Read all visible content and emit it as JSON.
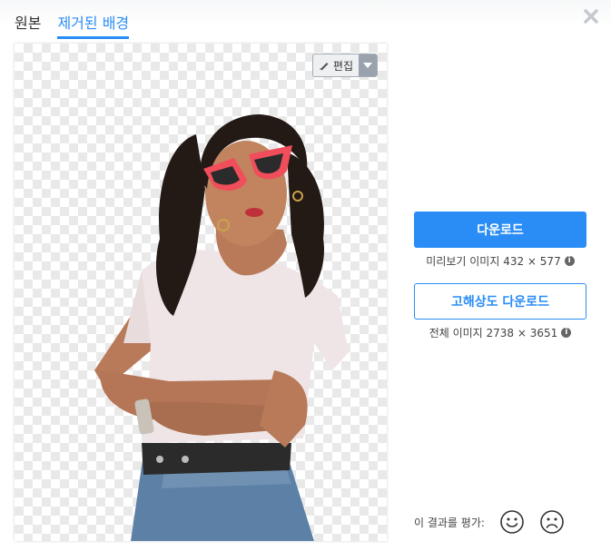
{
  "tabs": [
    {
      "label": "원본",
      "active": false
    },
    {
      "label": "제거된 배경",
      "active": true
    }
  ],
  "close": {
    "icon": "close-icon"
  },
  "preview": {
    "edit_label": "편집",
    "edit_icon": "brush-icon",
    "dropdown_icon": "caret-down-icon"
  },
  "download": {
    "label": "다운로드",
    "info": "미리보기 이미지 432 × 577"
  },
  "hd_download": {
    "label": "고해상도 다운로드",
    "info": "전체 이미지 2738 × 3651"
  },
  "rating": {
    "label": "이 결과를 평가:",
    "positive_icon": "smile-icon",
    "negative_icon": "frown-icon"
  },
  "colors": {
    "accent": "#2a8df5",
    "checker": "#e9e9e9"
  }
}
